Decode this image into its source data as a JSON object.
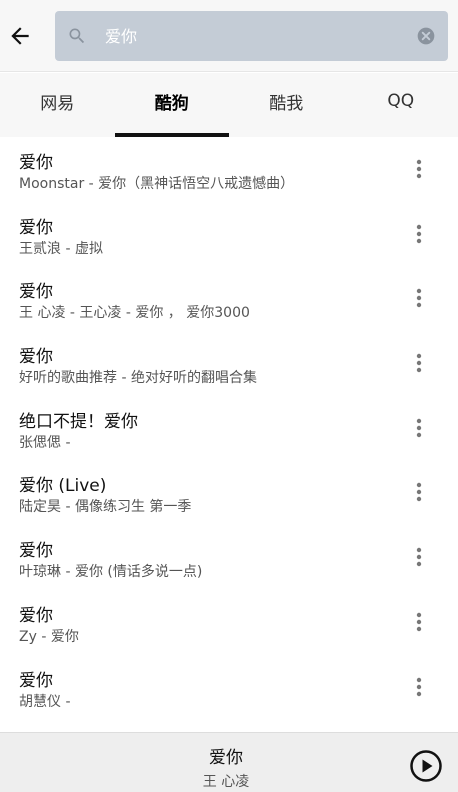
{
  "search": {
    "placeholder": "爱你",
    "value": ""
  },
  "tabs": [
    {
      "label": "网易",
      "active": false
    },
    {
      "label": "酷狗",
      "active": true
    },
    {
      "label": "酷我",
      "active": false
    },
    {
      "label": "QQ",
      "active": false
    }
  ],
  "songs": [
    {
      "title": "爱你",
      "subtitle": "Moonstar - 爱你（黑神话悟空八戒遗憾曲）"
    },
    {
      "title": "爱你",
      "subtitle": "王贰浪 - 虚拟"
    },
    {
      "title": "爱你",
      "subtitle": "王 心凌 - 王心凌 - 爱你 ， 爱你3000"
    },
    {
      "title": "爱你",
      "subtitle": "好听的歌曲推荐 - 绝对好听的翻唱合集"
    },
    {
      "title": "绝口不提！爱你",
      "subtitle": "张偲偲 -"
    },
    {
      "title": "爱你 (Live)",
      "subtitle": "陆定昊 - 偶像练习生 第一季"
    },
    {
      "title": "爱你",
      "subtitle": "叶琼琳 - 爱你 (情话多说一点)"
    },
    {
      "title": "爱你",
      "subtitle": "Zy - 爱你"
    },
    {
      "title": "爱你",
      "subtitle": "胡慧仪 -"
    }
  ],
  "player": {
    "title": "爱你",
    "artist": "王 心凌"
  },
  "icons": {
    "back": "arrow-left-icon",
    "search": "search-icon",
    "clear": "clear-circle-icon",
    "more": "more-vertical-icon",
    "play": "play-circle-icon"
  },
  "colors": {
    "search_bg": "#c4ccd6",
    "tab_indicator": "#111111",
    "player_bg": "#eeeeee"
  }
}
